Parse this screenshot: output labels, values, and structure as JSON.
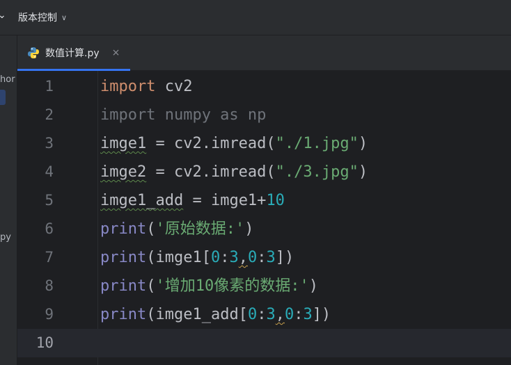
{
  "topbar": {
    "vcs_label": "版本控制"
  },
  "sidebar": {
    "fragment_top": "hor",
    "fragment_bottom": "py"
  },
  "tabs": [
    {
      "label": "数值计算.py",
      "active": true
    }
  ],
  "icons": {
    "python_file": "python-icon",
    "close": "close-icon",
    "vcs_chevron": "chevron-down-icon"
  },
  "colors": {
    "accent": "#3574f0",
    "keyword": "#cf8e6d",
    "string": "#6aab73",
    "number": "#2aacb8",
    "builtin": "#8888c6",
    "editor_bg": "#1e1f22"
  },
  "editor": {
    "current_line": 10,
    "lines": [
      {
        "n": "1",
        "kw": "import",
        "rest": " cv2"
      },
      {
        "n": "2",
        "text": "import numpy as np"
      },
      {
        "n": "3",
        "var": "imge1",
        "mid": " = cv2.imread(",
        "str": "\"./1.jpg\"",
        "end": ")"
      },
      {
        "n": "4",
        "var": "imge2",
        "mid": " = cv2.imread(",
        "str": "\"./3.jpg\"",
        "end": ")"
      },
      {
        "n": "5",
        "var": "imge1_add",
        "mid": " = imge1+",
        "num": "10"
      },
      {
        "n": "6",
        "fn": "print",
        "open": "(",
        "str": "'原始数据:'",
        "end": ")"
      },
      {
        "n": "7",
        "fn": "print",
        "open": "(imge1[",
        "a": "0",
        "colon1": ":",
        "b": "3",
        "comma": ",",
        "c": "0",
        "colon2": ":",
        "d": "3",
        "end": "])"
      },
      {
        "n": "8",
        "fn": "print",
        "open": "(",
        "str": "'增加10像素的数据:'",
        "end": ")"
      },
      {
        "n": "9",
        "fn": "print",
        "open": "(imge1_add[",
        "a": "0",
        "colon1": ":",
        "b": "3",
        "comma": ",",
        "c": "0",
        "colon2": ":",
        "d": "3",
        "end": "])"
      },
      {
        "n": "10"
      }
    ]
  }
}
